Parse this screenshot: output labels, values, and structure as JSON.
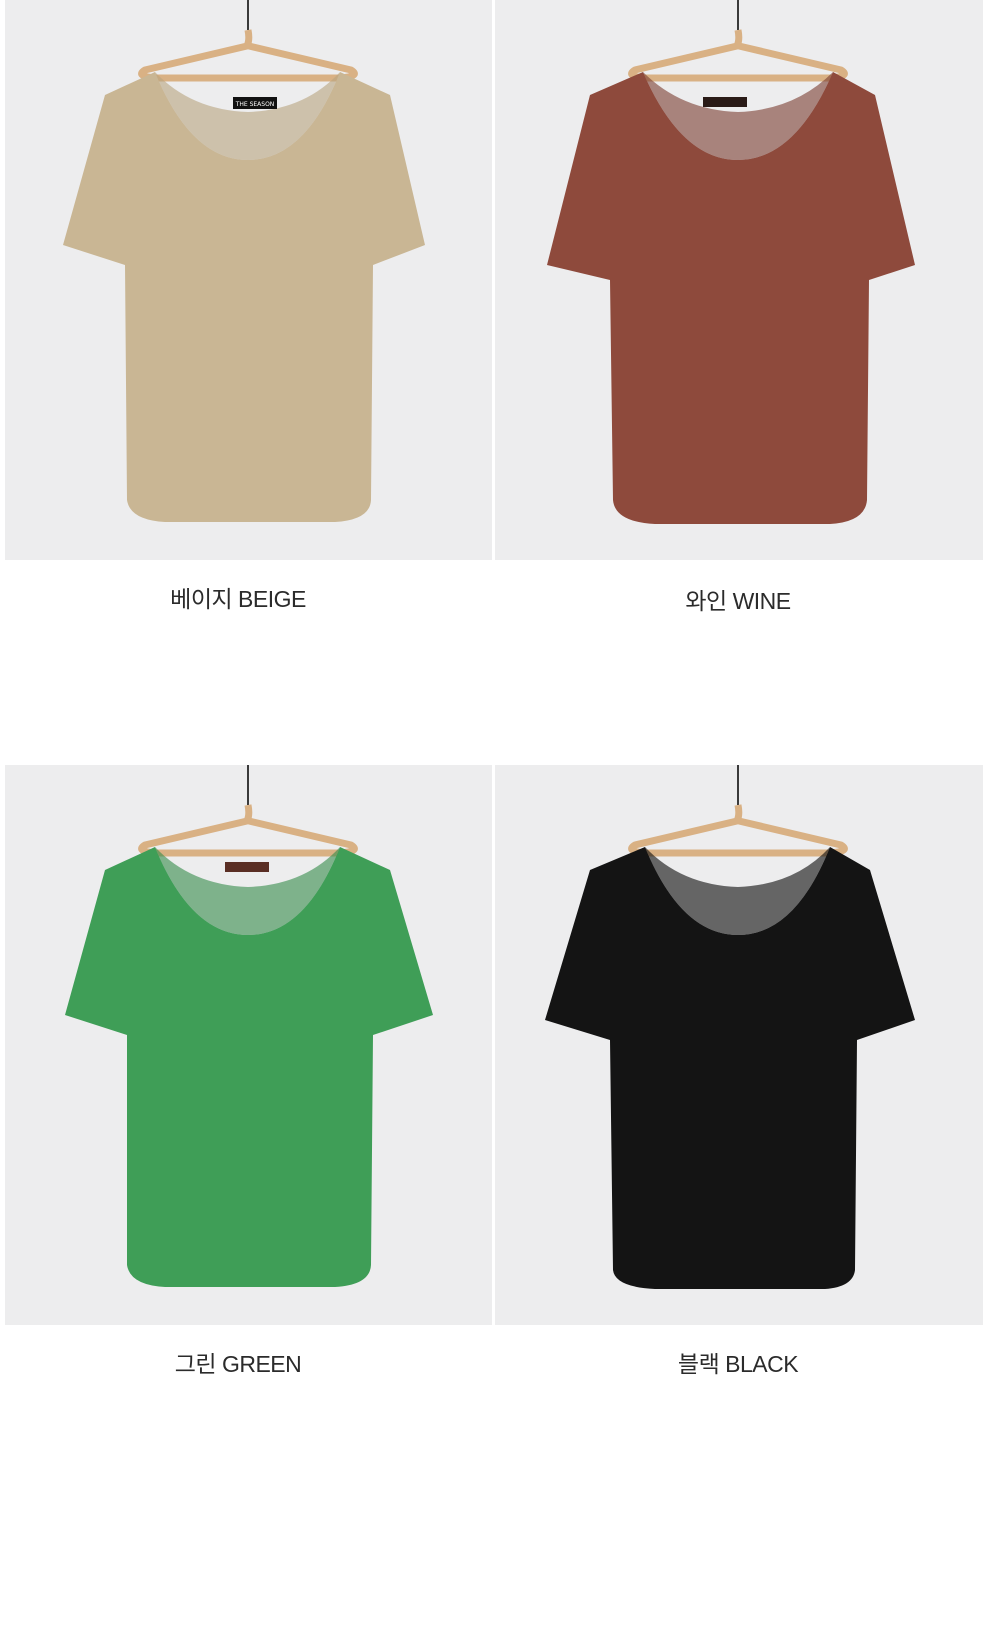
{
  "products": [
    {
      "label": "베이지 BEIGE",
      "color_name": "beige",
      "shirt_color": "#c9b694",
      "shirt_shade": "#b8a37f",
      "tag_text": "THE SEASON"
    },
    {
      "label": "와인 WINE",
      "color_name": "wine",
      "shirt_color": "#8e4a3c",
      "shirt_shade": "#7a3c30",
      "tag_text": ""
    },
    {
      "label": "그린 GREEN",
      "color_name": "green",
      "shirt_color": "#3f9e57",
      "shirt_shade": "#338a49",
      "tag_text": ""
    },
    {
      "label": "블랙 BLACK",
      "color_name": "black",
      "shirt_color": "#141414",
      "shirt_shade": "#0a0a0a",
      "tag_text": ""
    }
  ],
  "colors": {
    "background": "#ededee",
    "hanger": "#d9b184",
    "hanger_hook": "#3a3a3a"
  }
}
